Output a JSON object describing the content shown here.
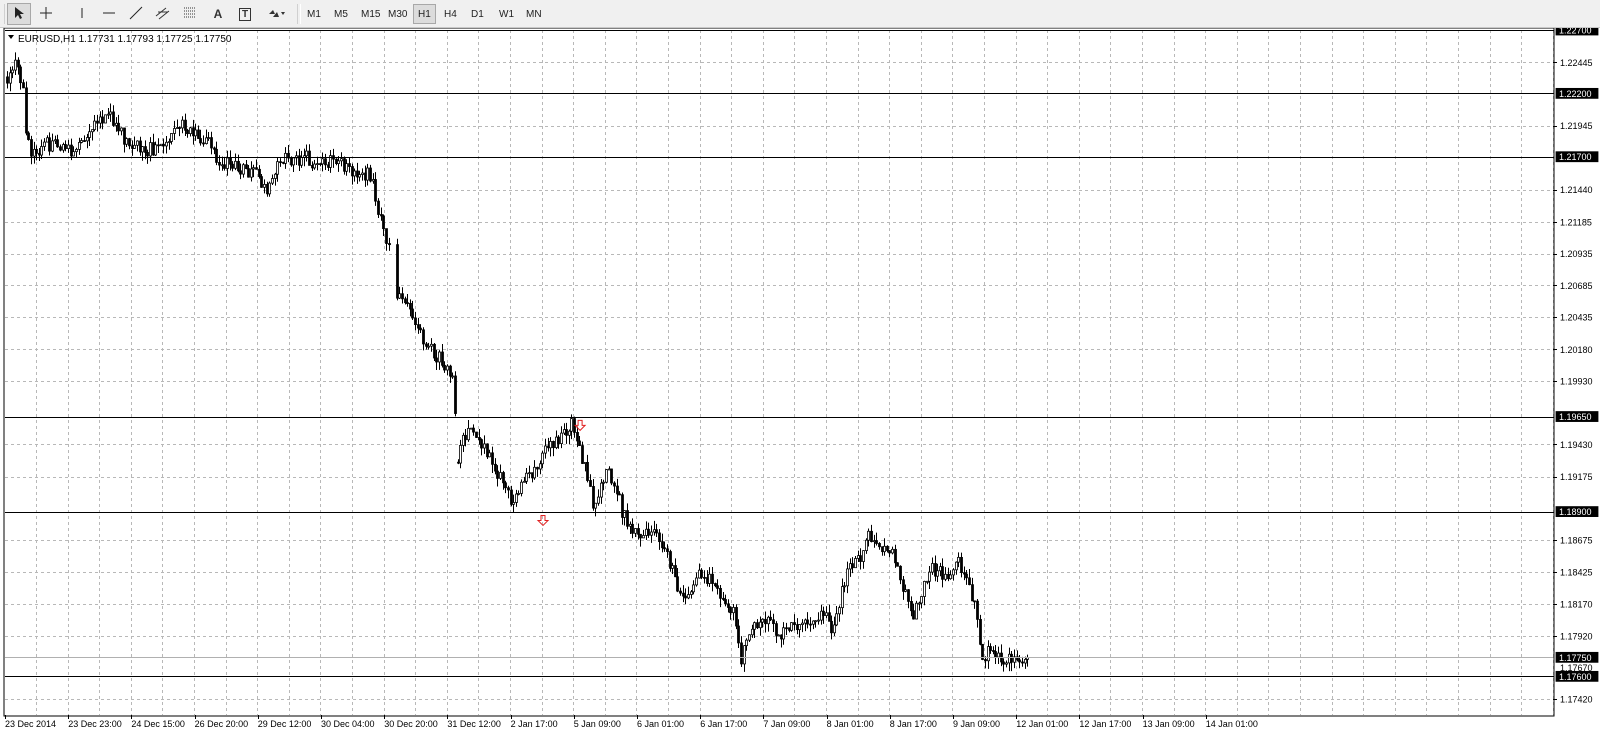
{
  "toolbar": {
    "tools": [
      {
        "name": "cursor-tool",
        "icon": "arrow-cursor-icon",
        "active": true
      },
      {
        "name": "crosshair-tool",
        "icon": "crosshair-icon",
        "active": false
      },
      {
        "name": "vertical-line-tool",
        "icon": "vertical-line-icon",
        "active": false
      },
      {
        "name": "horizontal-line-tool",
        "icon": "horizontal-line-icon",
        "active": false
      },
      {
        "name": "trendline-tool",
        "icon": "trendline-icon",
        "active": false
      },
      {
        "name": "equidistant-channel-tool",
        "icon": "channel-icon",
        "active": false
      },
      {
        "name": "fibonacci-tool",
        "icon": "fibonacci-icon",
        "active": false
      },
      {
        "name": "text-tool",
        "icon": "text-icon",
        "label": "A",
        "active": false
      },
      {
        "name": "text-label-tool",
        "icon": "text-label-icon",
        "label": "T",
        "active": false
      },
      {
        "name": "arrows-tool",
        "icon": "arrows-dropdown-icon",
        "active": false
      }
    ],
    "timeframes": [
      "M1",
      "M5",
      "M15",
      "M30",
      "H1",
      "H4",
      "D1",
      "W1",
      "MN"
    ],
    "active_timeframe": "H1"
  },
  "chart_info": {
    "symbol_line": "EURUSD,H1  1.17731 1.17793 1.17725 1.17750"
  },
  "chart_data": {
    "type": "candlestick",
    "symbol": "EURUSD",
    "timeframe": "H1",
    "ohlc": {
      "open": 1.17731,
      "high": 1.17793,
      "low": 1.17725,
      "close": 1.1775
    },
    "ylim": [
      1.17295,
      1.227
    ],
    "y_ticks": [
      "1.22445",
      "1.21945",
      "1.21440",
      "1.21185",
      "1.20935",
      "1.20685",
      "1.20435",
      "1.20180",
      "1.19930",
      "1.19430",
      "1.19175",
      "1.18675",
      "1.18425",
      "1.18170",
      "1.17920",
      "1.17420"
    ],
    "x_ticks": [
      "23 Dec 2014",
      "23 Dec 23:00",
      "24 Dec 15:00",
      "26 Dec 20:00",
      "29 Dec 12:00",
      "30 Dec 04:00",
      "30 Dec 20:00",
      "31 Dec 12:00",
      "2 Jan 17:00",
      "5 Jan 09:00",
      "6 Jan 01:00",
      "6 Jan 17:00",
      "7 Jan 09:00",
      "8 Jan 01:00",
      "8 Jan 17:00",
      "9 Jan 09:00",
      "12 Jan 01:00",
      "12 Jan 17:00",
      "13 Jan 09:00",
      "14 Jan 01:00"
    ],
    "horizontal_lines": [
      {
        "price": 1.227,
        "label": "1.22700"
      },
      {
        "price": 1.222,
        "label": "1.22200"
      },
      {
        "price": 1.217,
        "label": "1.21700"
      },
      {
        "price": 1.1965,
        "label": "1.19650"
      },
      {
        "price": 1.189,
        "label": "1.18900"
      },
      {
        "price": 1.176,
        "label": "1.17600"
      }
    ],
    "current_price": {
      "price": 1.1775,
      "label": "1.17750"
    },
    "minor_price_label": {
      "price": 1.1767,
      "label": "1.17670"
    },
    "sell_arrows": [
      {
        "index": 214,
        "price": 1.1958
      },
      {
        "index": 200,
        "price": 1.1883
      }
    ],
    "arrow_color": "#e02020",
    "close_path": [
      [
        0,
        1.2233
      ],
      [
        3,
        1.2242
      ],
      [
        6,
        1.2228
      ],
      [
        7,
        1.219
      ],
      [
        9,
        1.217
      ],
      [
        14,
        1.218
      ],
      [
        20,
        1.2178
      ],
      [
        25,
        1.2172
      ],
      [
        30,
        1.2188
      ],
      [
        34,
        1.2196
      ],
      [
        37,
        1.2205
      ],
      [
        40,
        1.2198
      ],
      [
        44,
        1.2185
      ],
      [
        48,
        1.218
      ],
      [
        52,
        1.2175
      ],
      [
        57,
        1.2177
      ],
      [
        62,
        1.2186
      ],
      [
        66,
        1.2198
      ],
      [
        70,
        1.2188
      ],
      [
        76,
        1.218
      ],
      [
        80,
        1.2165
      ],
      [
        85,
        1.2163
      ],
      [
        90,
        1.2158
      ],
      [
        93,
        1.216
      ],
      [
        95,
        1.2152
      ],
      [
        98,
        1.214
      ],
      [
        100,
        1.2155
      ],
      [
        104,
        1.217
      ],
      [
        108,
        1.2165
      ],
      [
        112,
        1.2172
      ],
      [
        116,
        1.2162
      ],
      [
        120,
        1.2164
      ],
      [
        124,
        1.2168
      ],
      [
        128,
        1.216
      ],
      [
        132,
        1.2158
      ],
      [
        136,
        1.2156
      ],
      [
        138,
        1.215
      ],
      [
        140,
        1.2128
      ],
      [
        142,
        1.211
      ],
      [
        144,
        1.21
      ],
      [
        145,
        1.2058
      ],
      [
        148,
        1.206
      ],
      [
        152,
        1.205
      ],
      [
        156,
        1.203
      ],
      [
        160,
        1.2018
      ],
      [
        164,
        1.2008
      ],
      [
        168,
        1.2
      ],
      [
        170,
        1.1925
      ],
      [
        171,
        1.194
      ],
      [
        174,
        1.1955
      ],
      [
        178,
        1.1945
      ],
      [
        182,
        1.1935
      ],
      [
        185,
        1.192
      ],
      [
        188,
        1.191
      ],
      [
        190,
        1.1895
      ],
      [
        194,
        1.1912
      ],
      [
        198,
        1.1922
      ],
      [
        202,
        1.1935
      ],
      [
        206,
        1.1942
      ],
      [
        210,
        1.195
      ],
      [
        213,
        1.1958
      ],
      [
        216,
        1.194
      ],
      [
        219,
        1.1915
      ],
      [
        221,
        1.1895
      ],
      [
        223,
        1.1905
      ],
      [
        226,
        1.192
      ],
      [
        229,
        1.1915
      ],
      [
        232,
        1.189
      ],
      [
        236,
        1.1875
      ],
      [
        240,
        1.1872
      ],
      [
        244,
        1.1878
      ],
      [
        247,
        1.1865
      ],
      [
        250,
        1.185
      ],
      [
        253,
        1.183
      ],
      [
        256,
        1.182
      ],
      [
        258,
        1.1828
      ],
      [
        261,
        1.1842
      ],
      [
        264,
        1.1838
      ],
      [
        268,
        1.1828
      ],
      [
        272,
        1.1818
      ],
      [
        275,
        1.1805
      ],
      [
        277,
        1.1775
      ],
      [
        280,
        1.179
      ],
      [
        284,
        1.1805
      ],
      [
        288,
        1.18
      ],
      [
        292,
        1.1792
      ],
      [
        296,
        1.1798
      ],
      [
        300,
        1.1803
      ],
      [
        304,
        1.18
      ],
      [
        308,
        1.181
      ],
      [
        311,
        1.1795
      ],
      [
        313,
        1.181
      ],
      [
        316,
        1.1835
      ],
      [
        319,
        1.1848
      ],
      [
        322,
        1.1855
      ],
      [
        325,
        1.187
      ],
      [
        328,
        1.1862
      ],
      [
        332,
        1.186
      ],
      [
        335,
        1.1855
      ],
      [
        338,
        1.183
      ],
      [
        342,
        1.1808
      ],
      [
        345,
        1.1825
      ],
      [
        348,
        1.1845
      ],
      [
        352,
        1.1842
      ],
      [
        356,
        1.1838
      ],
      [
        359,
        1.185
      ],
      [
        362,
        1.1838
      ],
      [
        365,
        1.1815
      ],
      [
        368,
        1.1775
      ],
      [
        371,
        1.1782
      ],
      [
        374,
        1.1778
      ],
      [
        378,
        1.1772
      ],
      [
        382,
        1.1775
      ],
      [
        385,
        1.1776
      ]
    ]
  }
}
